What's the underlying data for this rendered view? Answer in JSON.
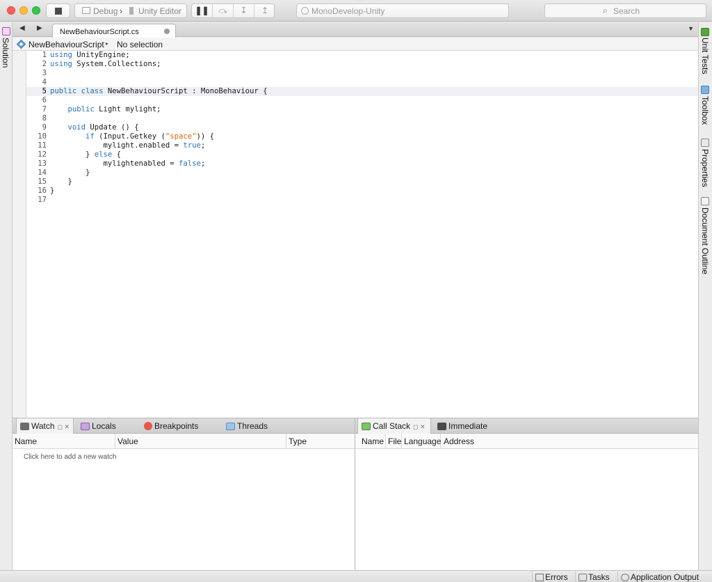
{
  "toolbar": {
    "config_label": "Debug",
    "config_separator": "›",
    "target_label": "Unity Editor",
    "status_text": "MonoDevelop-Unity",
    "search_placeholder": "Search",
    "debug_buttons": [
      "pause",
      "step-over",
      "step-into",
      "step-out"
    ]
  },
  "left_sidebar": {
    "solution_label": "Solution"
  },
  "right_sidebar": {
    "items": [
      {
        "label": "Unit Tests",
        "icon": "unit-tests-icon"
      },
      {
        "label": "Toolbox",
        "icon": "toolbox-icon"
      },
      {
        "label": "Properties",
        "icon": "properties-icon"
      },
      {
        "label": "Document Outline",
        "icon": "document-outline-icon"
      }
    ]
  },
  "document_tab": {
    "filename": "NewBehaviourScript.cs"
  },
  "pathbar": {
    "class_name": "NewBehaviourScript",
    "separator": "▸",
    "member": "No selection"
  },
  "editor": {
    "current_line": 5,
    "lines": [
      {
        "n": "1",
        "segs": [
          [
            "kw",
            "using"
          ],
          [
            "t",
            " UnityEngine;"
          ]
        ]
      },
      {
        "n": "2",
        "segs": [
          [
            "kw",
            "using"
          ],
          [
            "t",
            " System.Collections;"
          ]
        ]
      },
      {
        "n": "3",
        "segs": []
      },
      {
        "n": "4",
        "segs": []
      },
      {
        "n": "5",
        "segs": [
          [
            "kw",
            "public class"
          ],
          [
            "t",
            " NewBehaviourScript : MonoBehaviour {"
          ]
        ]
      },
      {
        "n": "6",
        "segs": []
      },
      {
        "n": "7",
        "segs": [
          [
            "t",
            "    "
          ],
          [
            "kw",
            "public"
          ],
          [
            "t",
            " Light mylight;"
          ]
        ]
      },
      {
        "n": "8",
        "segs": []
      },
      {
        "n": "9",
        "segs": [
          [
            "t",
            "    "
          ],
          [
            "kw",
            "void"
          ],
          [
            "t",
            " Update () {"
          ]
        ]
      },
      {
        "n": "10",
        "segs": [
          [
            "t",
            "        "
          ],
          [
            "kw",
            "if"
          ],
          [
            "t",
            " (Input.Getkey ("
          ],
          [
            "str",
            "\"space\""
          ],
          [
            "t",
            ")) {"
          ]
        ]
      },
      {
        "n": "11",
        "segs": [
          [
            "t",
            "            mylight.enabled = "
          ],
          [
            "kw",
            "true"
          ],
          [
            "t",
            ";"
          ]
        ]
      },
      {
        "n": "12",
        "segs": [
          [
            "t",
            "        } "
          ],
          [
            "kw",
            "else"
          ],
          [
            "t",
            " {"
          ]
        ]
      },
      {
        "n": "13",
        "segs": [
          [
            "t",
            "            mylightenabled = "
          ],
          [
            "kw",
            "false"
          ],
          [
            "t",
            ";"
          ]
        ]
      },
      {
        "n": "14",
        "segs": [
          [
            "t",
            "        }"
          ]
        ]
      },
      {
        "n": "15",
        "segs": [
          [
            "t",
            "    }"
          ]
        ]
      },
      {
        "n": "16",
        "segs": [
          [
            "t",
            "}"
          ]
        ]
      },
      {
        "n": "17",
        "segs": []
      }
    ]
  },
  "debug_left": {
    "tabs": [
      {
        "label": "Watch",
        "icon": "watch-icon",
        "active": true,
        "controls": "◻ ✕"
      },
      {
        "label": "Locals",
        "icon": "locals-icon"
      },
      {
        "label": "Breakpoints",
        "icon": "breakpoints-icon"
      },
      {
        "label": "Threads",
        "icon": "threads-icon"
      }
    ],
    "columns": [
      "Name",
      "Value",
      "Type"
    ],
    "add_watch_hint": "Click here to add a new watch"
  },
  "debug_right": {
    "tabs": [
      {
        "label": "Call Stack",
        "icon": "call-stack-icon",
        "active": true,
        "controls": "◻ ✕"
      },
      {
        "label": "Immediate",
        "icon": "immediate-icon"
      }
    ],
    "columns": [
      "Name",
      "File",
      "Language",
      "Address"
    ]
  },
  "statusbar": {
    "items": [
      {
        "label": "Errors",
        "icon": "errors-icon"
      },
      {
        "label": "Tasks",
        "icon": "tasks-icon"
      },
      {
        "label": "Application Output",
        "icon": "application-output-icon"
      }
    ]
  },
  "colors": {
    "keyword": "#2a72b8",
    "string": "#d9670b",
    "current_line": "#eef0f3"
  }
}
